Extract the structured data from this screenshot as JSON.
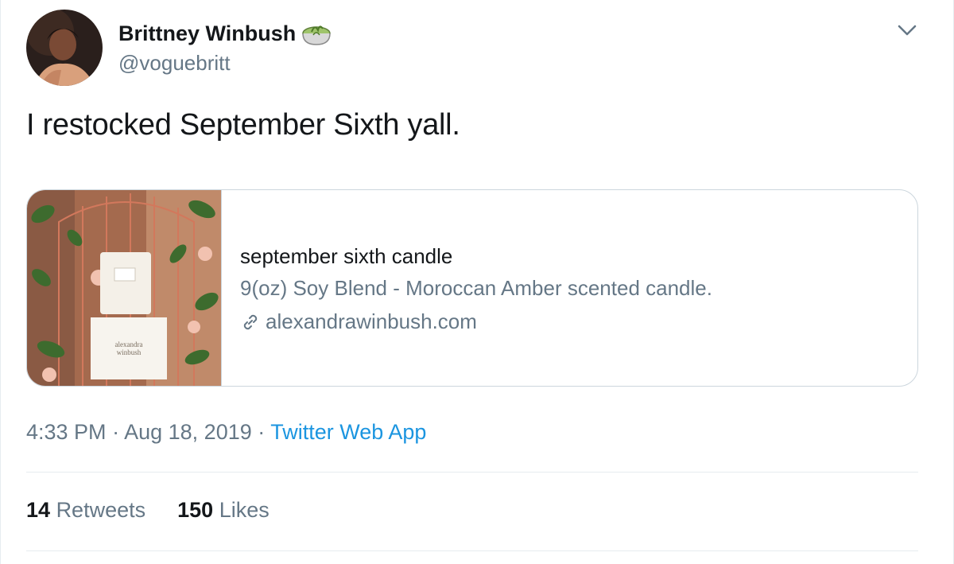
{
  "author": {
    "name": "Brittney Winbush",
    "handle": "@voguebritt"
  },
  "tweet": {
    "text": "I restocked September Sixth yall."
  },
  "card": {
    "title": "september sixth candle",
    "description": "9(oz) Soy Blend - Moroccan Amber scented candle.",
    "domain": "alexandrawinbush.com",
    "image_text": "alexandra winbush"
  },
  "meta": {
    "time": "4:33 PM",
    "separator": "·",
    "date": "Aug 18, 2019",
    "source": "Twitter Web App"
  },
  "stats": {
    "retweets_count": "14",
    "retweets_label": "Retweets",
    "likes_count": "150",
    "likes_label": "Likes"
  },
  "colors": {
    "text": "#14171a",
    "secondary": "#657786",
    "link": "#1b95e0",
    "border": "#ccd6dd"
  },
  "icons": {
    "emoji": "matcha-tea-emoji-icon",
    "caret": "chevron-down-icon",
    "link": "link-icon"
  }
}
